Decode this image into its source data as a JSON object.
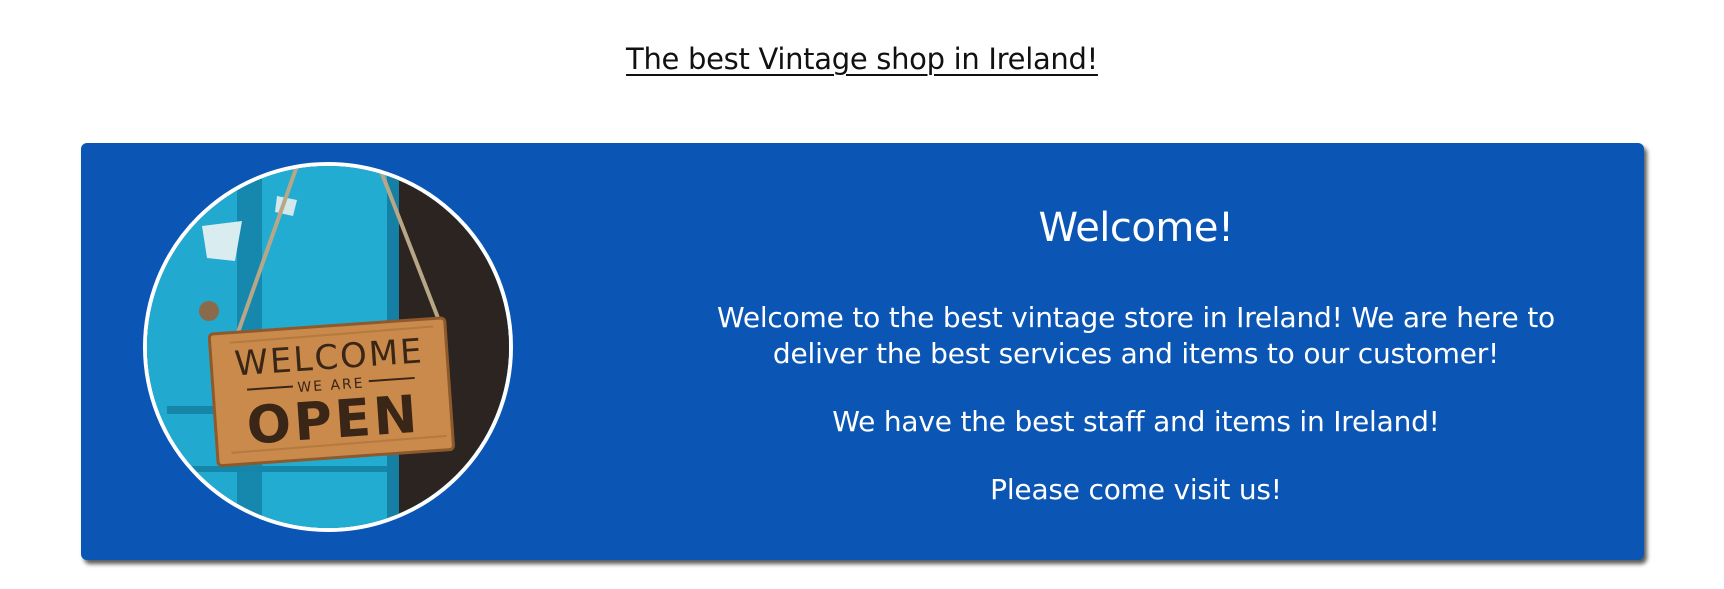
{
  "header": {
    "tagline": "The best Vintage shop in Ireland!"
  },
  "welcome": {
    "heading": "Welcome!",
    "paragraph_1": "Welcome to the best vintage store in Ireland! We are here to deliver the best services and items to our customer!",
    "paragraph_2": "We have the best staff and items in Ireland!",
    "paragraph_3": "Please come visit us!",
    "photo": {
      "sign_line_1": "WELCOME",
      "sign_line_2": "WE ARE",
      "sign_line_3": "OPEN"
    }
  },
  "colors": {
    "card_background": "#0b55b5",
    "card_text": "#ffffff",
    "door_blue": "#1fa3c8",
    "sign_wood": "#c98a4b"
  },
  "icons": {
    "photo": "welcome-open-sign-image"
  }
}
